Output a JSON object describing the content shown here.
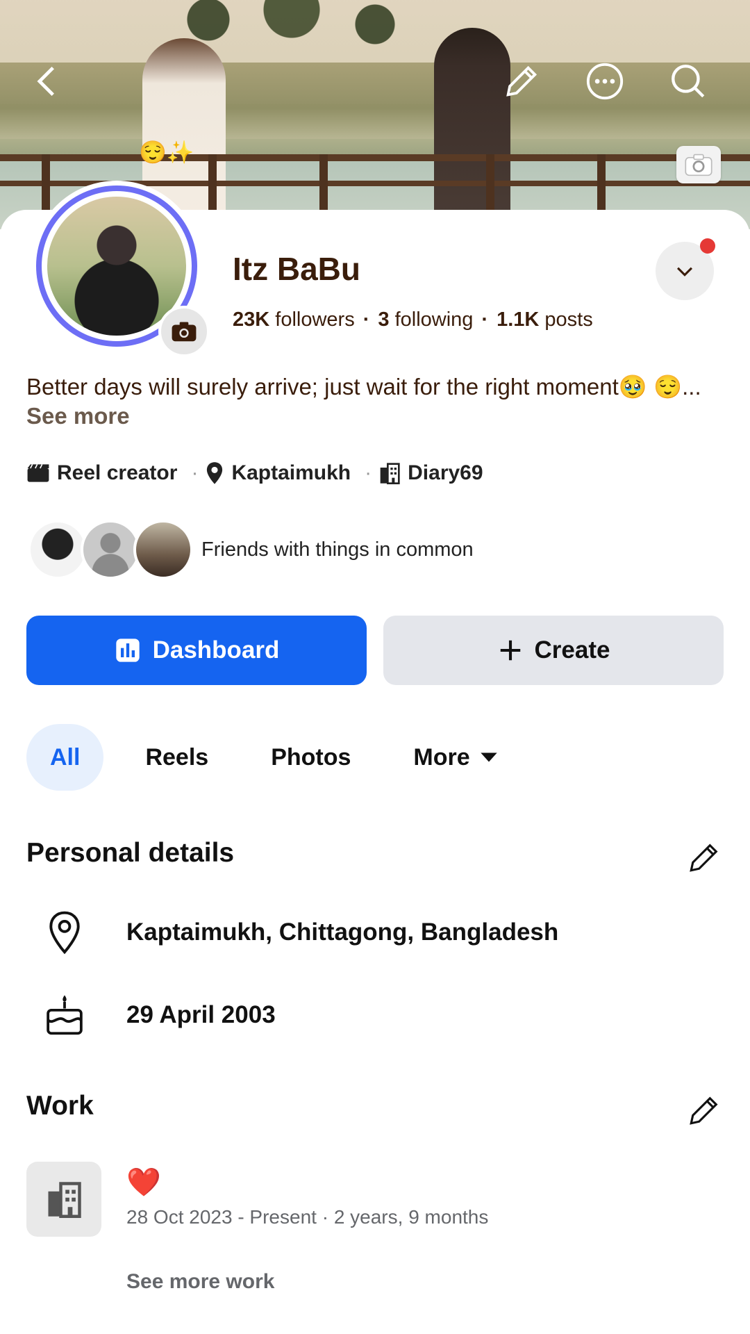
{
  "profile": {
    "name": "Itz BaBu",
    "followers_count": "23K",
    "followers_label": "followers",
    "following_count": "3",
    "following_label": "following",
    "posts_count": "1.1K",
    "posts_label": "posts",
    "bio": "Better days will surely arrive; just wait for the right moment🥹 😌...",
    "bio_see_more": "See more",
    "meta": [
      {
        "icon": "clapperboard-icon",
        "label": "Reel creator"
      },
      {
        "icon": "location-pin-icon",
        "label": "Kaptaimukh"
      },
      {
        "icon": "building-icon",
        "label": "Diary69"
      }
    ],
    "friends_label": "Friends with things in common"
  },
  "actions": {
    "dashboard_label": "Dashboard",
    "create_label": "Create"
  },
  "tabs": [
    {
      "label": "All",
      "active": true
    },
    {
      "label": "Reels",
      "active": false
    },
    {
      "label": "Photos",
      "active": false
    },
    {
      "label": "More",
      "active": false
    }
  ],
  "personal_details": {
    "title": "Personal details",
    "location": "Kaptaimukh, Chittagong, Bangladesh",
    "birthday": "29 April 2003"
  },
  "work": {
    "title": "Work",
    "entry_title": "❤️",
    "dates": "28 Oct 2023 - Present · 2 years, 9 months",
    "see_more": "See more work"
  },
  "colors": {
    "accent": "#1564f0",
    "ring": "#6d6ef5",
    "notification": "#e53935",
    "name_text": "#3a1d0b"
  },
  "cover_emoji": "😌✨"
}
